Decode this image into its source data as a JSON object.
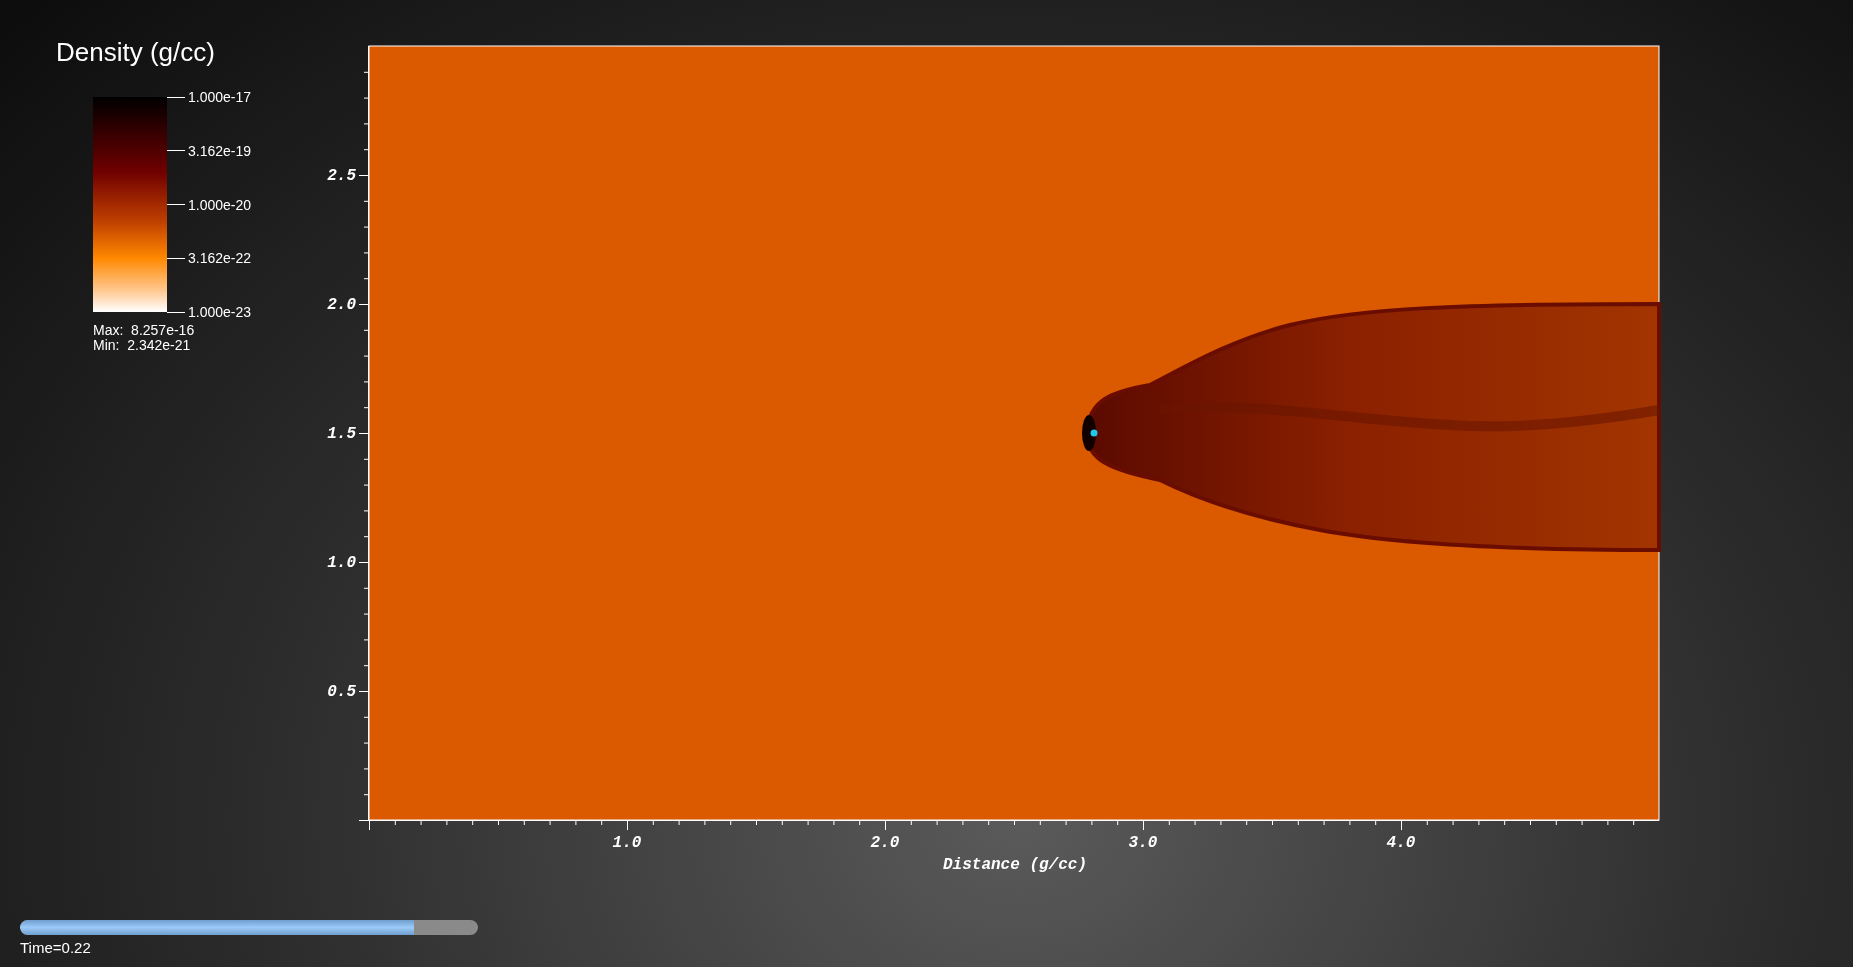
{
  "legend": {
    "title": "Density (g/cc)",
    "ticks": [
      "1.000e-17",
      "3.162e-19",
      "1.000e-20",
      "3.162e-22",
      "1.000e-23"
    ],
    "max": "Max:  8.257e-16",
    "min": "Min:  2.342e-21"
  },
  "plot": {
    "yticks": [
      "2.5",
      "2.0",
      "1.5",
      "1.0",
      "0.5"
    ],
    "xticks": [
      "1.0",
      "2.0",
      "3.0",
      "4.0"
    ],
    "xlabel": "Distance (g/cc)"
  },
  "time_slider": {
    "level": 0.86,
    "label": "Time=0.22"
  }
}
